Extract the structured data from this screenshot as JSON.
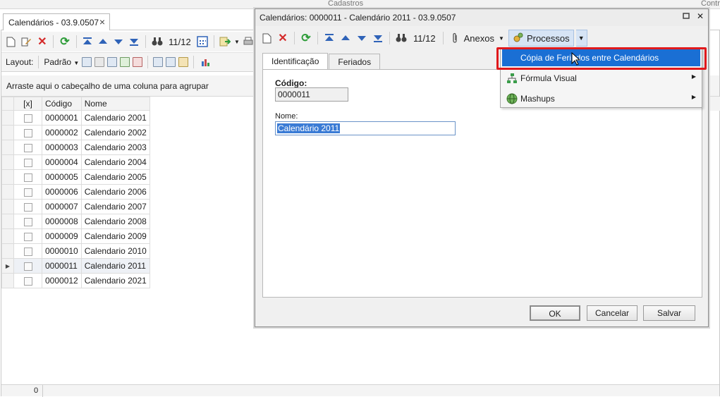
{
  "top_strip": {
    "left_label": "Cadastros",
    "right_label": "Contr"
  },
  "doc_tab": {
    "title": "Calendários - 03.9.0507",
    "close": "×"
  },
  "main_toolbar": {
    "counter": "11/12"
  },
  "layout_bar": {
    "layout_label": "Layout:",
    "layout_value": "Padrão"
  },
  "group_hint": "Arraste aqui o cabeçalho de uma coluna para agrupar",
  "grid": {
    "columns": [
      "[x]",
      "Código",
      "Nome"
    ],
    "rows": [
      {
        "code": "0000001",
        "name": "Calendario 2001"
      },
      {
        "code": "0000002",
        "name": "Calendario 2002"
      },
      {
        "code": "0000003",
        "name": "Calendario 2003"
      },
      {
        "code": "0000004",
        "name": "Calendario 2004"
      },
      {
        "code": "0000005",
        "name": "Calendario 2005"
      },
      {
        "code": "0000006",
        "name": "Calendario 2006"
      },
      {
        "code": "0000007",
        "name": "Calendario 2007"
      },
      {
        "code": "0000008",
        "name": "Calendario 2008"
      },
      {
        "code": "0000009",
        "name": "Calendario 2009"
      },
      {
        "code": "0000010",
        "name": "Calendario 2010"
      },
      {
        "code": "0000011",
        "name": "Calendario 2011"
      },
      {
        "code": "0000012",
        "name": "Calendario 2021"
      }
    ],
    "current_row_index": 10
  },
  "footer": {
    "count": "0"
  },
  "modal": {
    "title": "Calendários: 0000011 - Calendário 2011 - 03.9.0507",
    "counter": "11/12",
    "anexos": "Anexos",
    "processos": "Processos",
    "tabs": [
      "Identificação",
      "Feriados"
    ],
    "codigo_label": "Código:",
    "codigo_value": "0000011",
    "nome_label": "Nome:",
    "nome_value": "Calendário 2011",
    "ok": "OK",
    "cancelar": "Cancelar",
    "salvar": "Salvar"
  },
  "menu": {
    "items": [
      {
        "label": "Cópia de Feriados entre Calendários",
        "submenu": false
      },
      {
        "label": "Fórmula Visual",
        "submenu": true
      },
      {
        "label": "Mashups",
        "submenu": true
      }
    ]
  },
  "colors": {
    "highlight": "#1a6fd4",
    "annotation_box": "#e0191c",
    "delete_red": "#d42a2a",
    "refresh_green": "#2f9d3a"
  }
}
